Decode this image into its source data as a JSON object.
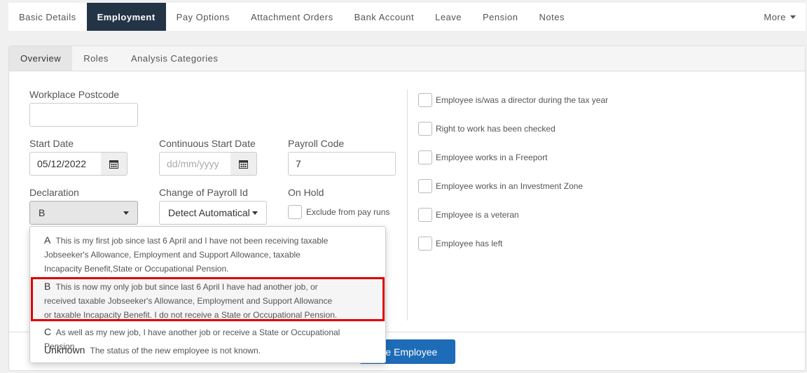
{
  "top_nav": {
    "tabs": [
      "Basic Details",
      "Employment",
      "Pay Options",
      "Attachment Orders",
      "Bank Account",
      "Leave",
      "Pension",
      "Notes"
    ],
    "more": "More"
  },
  "sub_tabs": [
    "Overview",
    "Roles",
    "Analysis Categories"
  ],
  "form": {
    "workplace_postcode_label": "Workplace Postcode",
    "workplace_postcode_value": "",
    "start_date_label": "Start Date",
    "start_date_value": "05/12/2022",
    "continuous_start_label": "Continuous Start Date",
    "continuous_start_placeholder": "dd/mm/yyyy",
    "payroll_code_label": "Payroll Code",
    "payroll_code_value": "7",
    "declaration_label": "Declaration",
    "declaration_value": "B",
    "change_payroll_label": "Change of Payroll Id",
    "change_payroll_value": "Detect Automatical",
    "on_hold_label": "On Hold",
    "exclude_label": "Exclude from pay runs"
  },
  "checkboxes": [
    "Employee is/was a director during the tax year",
    "Right to work has been checked",
    "Employee works in a Freeport",
    "Employee works in an Investment Zone",
    "Employee is a veteran",
    "Employee has left"
  ],
  "dropdown": {
    "options": [
      {
        "key": "A",
        "lines": [
          "This is my first job since last 6 April and I have not been receiving taxable",
          "Jobseeker's Allowance, Employment and Support Allowance, taxable",
          "Incapacity Benefit,State or Occupational Pension."
        ]
      },
      {
        "key": "B",
        "lines": [
          "This is now my only job but since last 6 April I have had another job, or",
          "received taxable Jobseeker's Allowance, Employment and Support Allowance",
          "or taxable Incapacity Benefit. I do not receive a State or Occupational Pension."
        ]
      },
      {
        "key": "C",
        "lines": [
          "As well as my new job, I have another job or receive a State or Occupational Pension."
        ]
      },
      {
        "key": "Unknown",
        "lines": [
          "The status of the new employee is not known."
        ]
      }
    ]
  },
  "primary_button": "ate Employee"
}
